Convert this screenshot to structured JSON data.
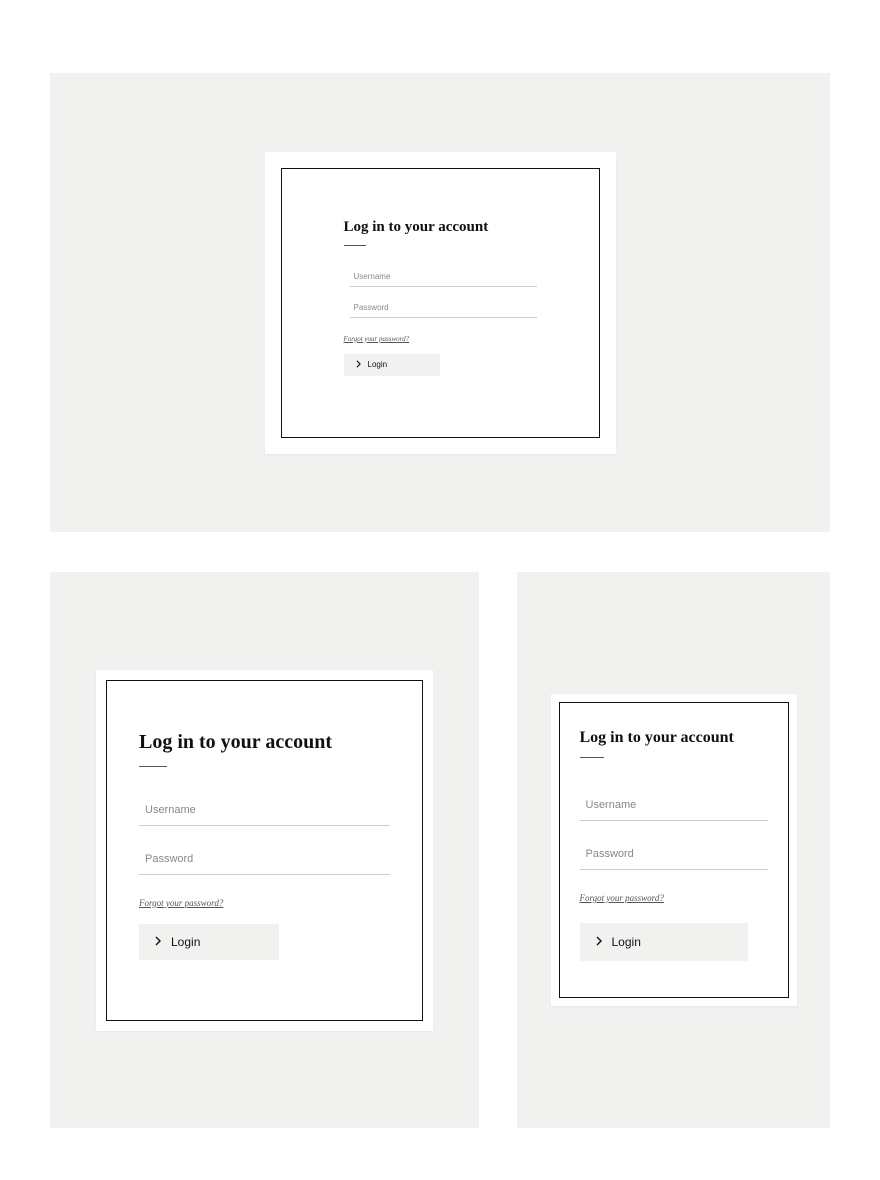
{
  "login": {
    "heading": "Log in to your account",
    "username_placeholder": "Username",
    "password_placeholder": "Password",
    "forgot_label": "Forgot your password?",
    "login_button_label": "Login"
  }
}
